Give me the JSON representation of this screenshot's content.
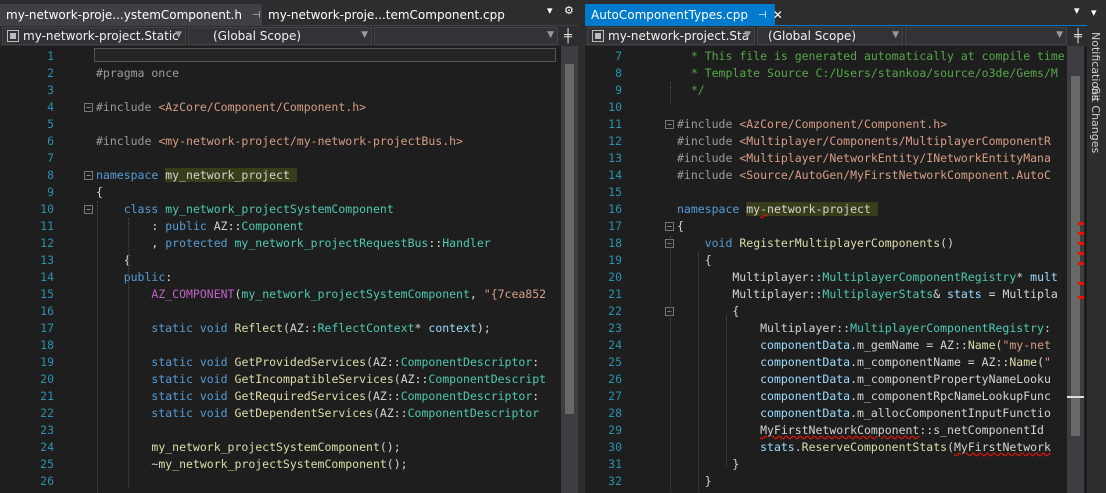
{
  "left": {
    "tabs": [
      {
        "label": "my-network-proje...ystemComponent.h",
        "pin": "⊣"
      },
      {
        "label": "my-network-proje...temComponent.cpp"
      }
    ],
    "nav": {
      "project": "my-network-project.Static",
      "scope": "(Global Scope)",
      "member": ""
    },
    "lines": [
      {
        "n": "1",
        "html": ""
      },
      {
        "n": "2",
        "html": "<span class='pp'>#pragma once</span>"
      },
      {
        "n": "3",
        "html": ""
      },
      {
        "n": "4",
        "html": "<span class='pp'>#include</span> <span class='inc'>&lt;AzCore/Component/Component.h&gt;</span>",
        "fold": "-"
      },
      {
        "n": "5",
        "html": ""
      },
      {
        "n": "6",
        "html": "<span class='pp'>#include</span> <span class='inc'>&lt;my-network-project/my-network-projectBus.h&gt;</span>"
      },
      {
        "n": "7",
        "html": ""
      },
      {
        "n": "8",
        "html": "<span class='kw'>namespace</span> <span class='hl'>my_network_project </span>",
        "fold": "-"
      },
      {
        "n": "9",
        "html": "{"
      },
      {
        "n": "10",
        "html": "    <span class='kw'>class</span> <span class='ty'>my_network_projectSystemComponent</span>",
        "fold": "-"
      },
      {
        "n": "11",
        "html": "        : <span class='kw'>public</span> AZ::<span class='ty'>Component</span>"
      },
      {
        "n": "12",
        "html": "        , <span class='kw'>protected</span> <span class='ty'>my_network_projectRequestBus</span>::<span class='ty'>Handler</span>"
      },
      {
        "n": "13",
        "html": "    {"
      },
      {
        "n": "14",
        "html": "    <span class='kw'>public</span>:"
      },
      {
        "n": "15",
        "html": "        <span class='mac'>AZ_COMPONENT</span>(<span class='ty'>my_network_projectSystemComponent</span>, <span class='str'>\"{7cea852</span>"
      },
      {
        "n": "16",
        "html": ""
      },
      {
        "n": "17",
        "html": "        <span class='kw'>static</span> <span class='kw'>void</span> <span class='fn'>Reflect</span>(AZ::<span class='ty'>ReflectContext</span>* <span class='mem'>context</span>);"
      },
      {
        "n": "18",
        "html": ""
      },
      {
        "n": "19",
        "html": "        <span class='kw'>static</span> <span class='kw'>void</span> <span class='fn'>GetProvidedServices</span>(AZ::<span class='ty'>ComponentDescriptor</span>:"
      },
      {
        "n": "20",
        "html": "        <span class='kw'>static</span> <span class='kw'>void</span> <span class='fn'>GetIncompatibleServices</span>(AZ::<span class='ty'>ComponentDescript</span>"
      },
      {
        "n": "21",
        "html": "        <span class='kw'>static</span> <span class='kw'>void</span> <span class='fn'>GetRequiredServices</span>(AZ::<span class='ty'>ComponentDescriptor</span>:"
      },
      {
        "n": "22",
        "html": "        <span class='kw'>static</span> <span class='kw'>void</span> <span class='fn'>GetDependentServices</span>(AZ::<span class='ty'>ComponentDescriptor</span>"
      },
      {
        "n": "23",
        "html": ""
      },
      {
        "n": "24",
        "html": "        <span class='fn'>my_network_projectSystemComponent</span>();"
      },
      {
        "n": "25",
        "html": "        ~<span class='fn'>my_network_projectSystemComponent</span>();"
      },
      {
        "n": "26",
        "html": ""
      }
    ]
  },
  "right": {
    "tabs": [
      {
        "label": "AutoComponentTypes.cpp",
        "pin": "⊣",
        "close": "✕"
      }
    ],
    "nav": {
      "project": "my-network-project.Sta",
      "scope": "(Global Scope)",
      "member": ""
    },
    "lines": [
      {
        "n": "7",
        "html": "  <span class='cm'>* This file is generated automatically at compile time</span>"
      },
      {
        "n": "8",
        "html": "  <span class='cm'>* Template Source C:/Users/stankoa/source/o3de/Gems/M</span>"
      },
      {
        "n": "9",
        "html": "  <span class='cm'>*/</span>"
      },
      {
        "n": "10",
        "html": ""
      },
      {
        "n": "11",
        "html": "<span class='pp'>#include</span> <span class='inc'>&lt;AzCore/Component/Component.h&gt;</span>",
        "fold": "-"
      },
      {
        "n": "12",
        "html": "<span class='pp'>#include</span> <span class='inc'>&lt;Multiplayer/Components/MultiplayerComponentR</span>"
      },
      {
        "n": "13",
        "html": "<span class='pp'>#include</span> <span class='inc'>&lt;Multiplayer/NetworkEntity/INetworkEntityMana</span>"
      },
      {
        "n": "14",
        "html": "<span class='pp'>#include</span> <span class='inc'>&lt;Source/AutoGen/MyFirstNetworkComponent.AutoC</span>"
      },
      {
        "n": "15",
        "html": ""
      },
      {
        "n": "16",
        "html": "<span class='kw'>namespace</span> <span class='hl'>my<span class='squig'>-</span>network-project </span>"
      },
      {
        "n": "17",
        "html": "{",
        "fold": "-"
      },
      {
        "n": "18",
        "html": "    <span class='kw'>void</span> <span class='fn'>RegisterMultiplayerComponents</span>()",
        "fold": "-"
      },
      {
        "n": "19",
        "html": "    {"
      },
      {
        "n": "20",
        "html": "        Multiplayer::<span class='ty'>MultiplayerComponentRegistry</span>* <span class='mem'>mult</span>"
      },
      {
        "n": "21",
        "html": "        Multiplayer::<span class='ty'>MultiplayerStats</span>&amp; <span class='mem'>stats</span> = Multipla"
      },
      {
        "n": "22",
        "html": "        {",
        "fold": "-"
      },
      {
        "n": "23",
        "html": "            Multiplayer::<span class='ty'>MultiplayerComponentRegistry</span>:"
      },
      {
        "n": "24",
        "html": "            <span class='mem'>componentData</span>.m_gemName = AZ::<span class='fn'>Name</span>(<span class='str'>\"my-net</span>"
      },
      {
        "n": "25",
        "html": "            <span class='mem'>componentData</span>.m_componentName = AZ::<span class='fn'>Name</span>(<span class='str'>\"</span>"
      },
      {
        "n": "26",
        "html": "            <span class='mem'>componentData</span>.m_componentPropertyNameLooku"
      },
      {
        "n": "27",
        "html": "            <span class='mem'>componentData</span>.m_componentRpcNameLookupFunc"
      },
      {
        "n": "28",
        "html": "            <span class='mem'>componentData</span>.m_allocComponentInputFunctio"
      },
      {
        "n": "29",
        "html": "            <span class='squig'>MyFirstNetworkComponent</span>::s_netComponentId"
      },
      {
        "n": "30",
        "html": "            <span class='mem'>stats</span>.<span class='fn'>ReserveComponentStats</span>(<span class='squig'>MyFirstNetwork</span>"
      },
      {
        "n": "31",
        "html": "        }"
      },
      {
        "n": "32",
        "html": "    }"
      }
    ]
  },
  "window_controls": {
    "dropdown": "▾",
    "gear": "⚙"
  },
  "sidebar": {
    "notifications": "Notifications",
    "git_changes": "Git Changes"
  },
  "colors": {
    "accent": "#007acc",
    "error": "#e51400",
    "line_number": "#2b91af"
  }
}
